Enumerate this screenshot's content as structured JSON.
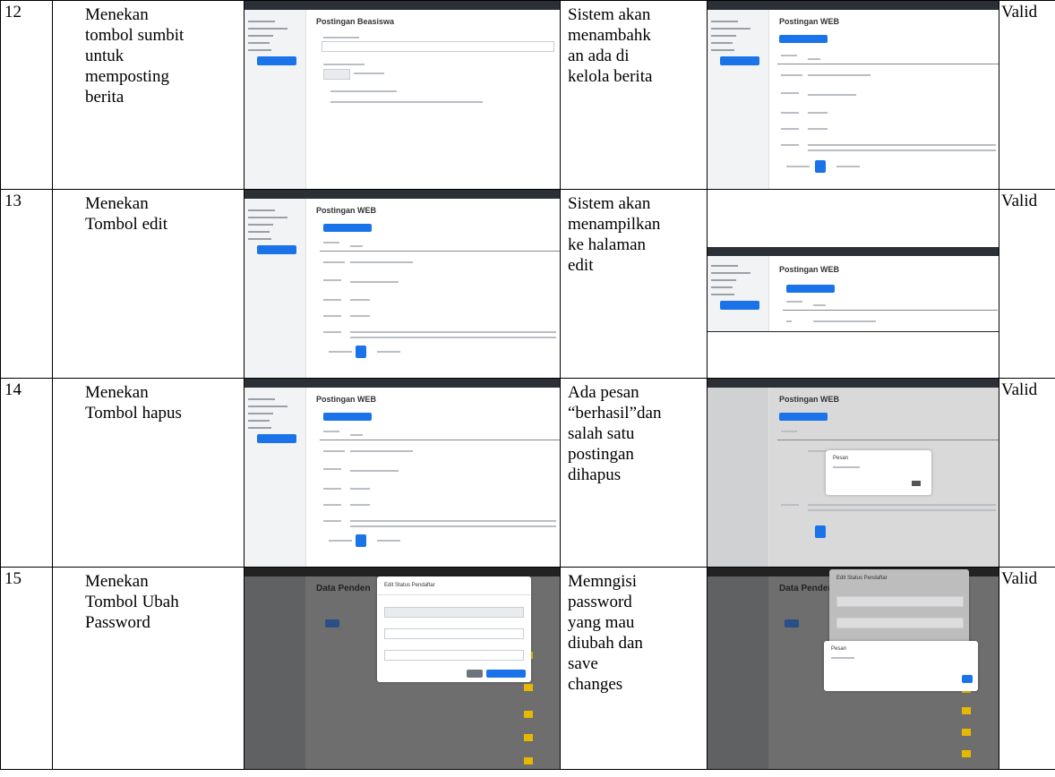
{
  "rows": [
    {
      "no": "12",
      "step": [
        "Menekan",
        "tombol sumbit",
        "untuk",
        "memposting",
        "berita"
      ],
      "result": [
        "Sistem akan",
        "menambahk",
        "an ada di",
        "kelola berita"
      ],
      "status": "Valid",
      "shot_a_title": "Postingan Beasiswa",
      "shot_b_title": "Postingan WEB"
    },
    {
      "no": "13",
      "step": [
        "Menekan",
        "Tombol edit"
      ],
      "result": [
        "Sistem akan",
        "menampilkan",
        "ke halaman",
        "edit"
      ],
      "status": "Valid",
      "shot_a_title": "Postingan WEB",
      "shot_b_title": "Postingan WEB"
    },
    {
      "no": "14",
      "step": [
        "Menekan",
        "Tombol hapus"
      ],
      "result": [
        "Ada pesan",
        "“berhasil”dan",
        "salah satu",
        "postingan",
        "dihapus"
      ],
      "status": "Valid",
      "shot_a_title": "Postingan WEB",
      "shot_b_title": "Postingan WEB",
      "shot_b_modal_title": "Pesan"
    },
    {
      "no": "15",
      "step": [
        "Menekan",
        "Tombol Ubah",
        "Password"
      ],
      "result": [
        "Memngisi",
        "password",
        "yang mau",
        "diubah dan",
        "save",
        "changes"
      ],
      "status": "Valid",
      "shot_a_title": "Data Penden",
      "shot_a_modal_title": "Edit Status Pendaftar",
      "shot_b_title": "Data Penden",
      "shot_b_modal_title": "Edit Status Pendaftar",
      "shot_b_alert_title": "Pesan"
    }
  ]
}
